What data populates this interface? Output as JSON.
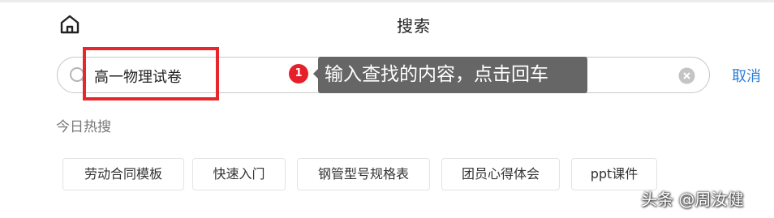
{
  "header": {
    "title": "搜索",
    "home_icon": "home-icon"
  },
  "search": {
    "value": "高一物理试卷",
    "search_icon": "search-icon",
    "clear_icon": "clear-circle-icon",
    "cancel_label": "取消"
  },
  "annotation": {
    "step_number": "1",
    "tooltip_text": "输入查找的内容，点击回车",
    "highlight_color": "#e8262b",
    "badge_color": "#e5202a"
  },
  "hot_searches": {
    "heading": "今日热搜",
    "items": [
      {
        "label": "劳动合同模板"
      },
      {
        "label": "快速入门"
      },
      {
        "label": "钢管型号规格表"
      },
      {
        "label": "团员心得体会"
      },
      {
        "label": "ppt课件"
      }
    ]
  },
  "watermark": {
    "text": "头条 @周汝健"
  },
  "colors": {
    "accent_link": "#2b7fd8",
    "tooltip_bg": "#666666"
  }
}
